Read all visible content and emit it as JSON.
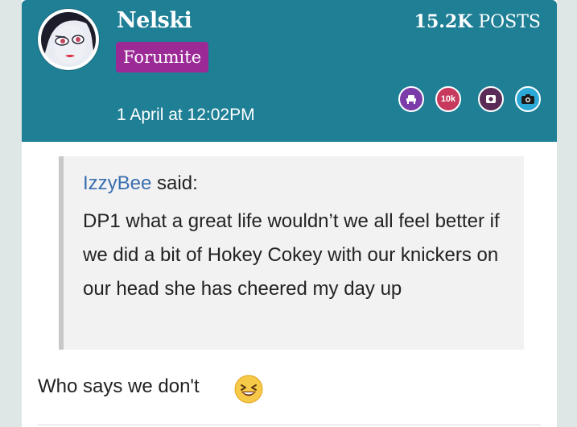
{
  "post": {
    "username": "Nelski",
    "role": "Forumite",
    "posts_count": "15.2K",
    "posts_label": "POSTS",
    "timestamp": "1 April at 12:02PM",
    "awards": [
      {
        "name": "armchair-award-icon",
        "color": "#7b3ba8"
      },
      {
        "name": "10k-award-icon",
        "label": "10k",
        "color": "#c73a5e"
      },
      {
        "name": "wallet-award-icon",
        "color": "#5a2b56"
      },
      {
        "name": "camera-award-icon",
        "color": "#2aa9d6"
      }
    ],
    "quote": {
      "author": "IzzyBee",
      "said_label": "said:",
      "body": "DP1 what a great life wouldn’t we all feel better if we did a bit of Hokey Cokey with our knickers on our head she has cheered my day up"
    },
    "reply_text": "Who says we don't",
    "reply_emoji": "laughing-emoji-icon"
  },
  "colors": {
    "header_bg": "#1e7f95",
    "role_badge_bg": "#9b2a97",
    "quote_author": "#3a6fb0",
    "page_bg": "#dfe6e6"
  }
}
